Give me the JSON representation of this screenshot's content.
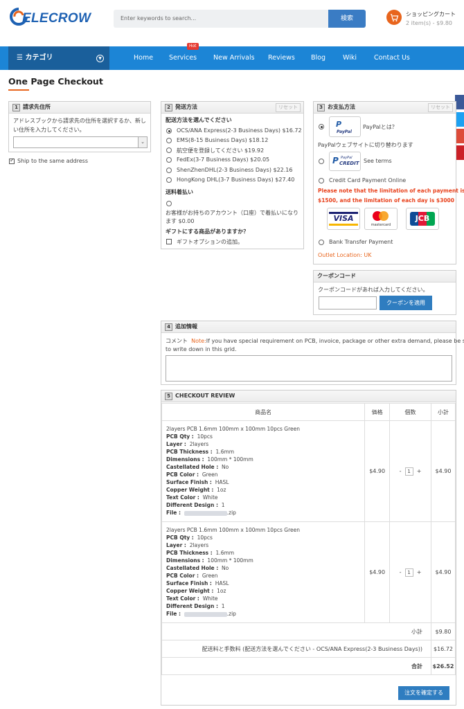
{
  "header": {
    "brand": "ELECROW",
    "search_placeholder": "Enter keywords to search...",
    "search_button": "検索",
    "cart_title": "ショッピングカート",
    "cart_summary": "2 item(s) - $9.80"
  },
  "nav": {
    "categories": "カテゴリ",
    "items": [
      "Home",
      "Services",
      "New Arrivals",
      "Reviews",
      "Blog",
      "Wiki",
      "Contact Us"
    ],
    "hot_badge": "Hot"
  },
  "page_title": "One Page Checkout",
  "billing": {
    "num": "1",
    "title": "請求先住所",
    "desc_line1": "アドレスブックから請求先の住所を選択するか、新し",
    "desc_line2": "い住所を入力してください。",
    "select_value": "",
    "same_address": "Ship to the same address"
  },
  "shipping": {
    "num": "2",
    "title": "発送方法",
    "reset": "リセット",
    "choose": "配送方法を選んでください",
    "options": [
      "OCS/ANA Express(2-3 Business Days) $16.72",
      "EMS(8-15 Business Days) $18.12",
      "航空便を登録してください $19.92",
      "FedEx(3-7 Business Days) $20.05",
      "ShenZhenDHL(2-3 Business Days) $22.16",
      "HongKong DHL(3-7 Business Days) $27.40"
    ],
    "cod_title": "送料着払い",
    "cod_desc_line1": "お客様がお持ちのアカウント（口座）で着払いになり",
    "cod_desc_line2": "ます $0.00",
    "gift_title": "ギフトにする商品がありますか？",
    "gift_option": "ギフトオプションの追加。"
  },
  "payment": {
    "num": "3",
    "title": "お支払方法",
    "reset": "リセット",
    "paypal_what": "PayPalとは？",
    "paypal_redirect": "PayPalウェブサイトに切り替わります",
    "paypal_credit_terms": "See terms",
    "credit_card": "Credit Card Payment Online",
    "limit_note_line1": "Please note that the limitation of each payment is",
    "limit_note_line2": "$1500, and the limitation of each day is $3000",
    "bank_transfer": "Bank Transfer Payment",
    "outlet": "Outlet Location: UK",
    "paypal_logo": "PayPal",
    "paypal_credit_logo_top": "PayPal",
    "paypal_credit_logo_bottom": "CREDIT",
    "visa": "VISA",
    "mastercard": "mastercard",
    "jcb": "JCB"
  },
  "coupon": {
    "title": "クーポンコード",
    "desc": "クーポンコードがあれば入力してください。",
    "button": "クーポンを適用",
    "value": ""
  },
  "additional": {
    "num": "4",
    "title": "追加情報",
    "comment_label": "コメント",
    "note_label": "Note:",
    "note_line1": "If you have special requirement on PCB, invoice, package or other extra demand, please be sure",
    "note_line2": "to write down in this grid."
  },
  "review": {
    "num": "5",
    "title": "CHECKOUT REVIEW",
    "headers": [
      "商品名",
      "価格",
      "個数",
      "小計"
    ],
    "items": [
      {
        "name": "2layers PCB 1.6mm 100mm x 100mm 10pcs Green",
        "specs": [
          {
            "k": "PCB Qty :",
            "v": "10pcs"
          },
          {
            "k": "Layer :",
            "v": "2layers"
          },
          {
            "k": "PCB Thickness :",
            "v": "1.6mm"
          },
          {
            "k": "Dimensions :",
            "v": "100mm * 100mm"
          },
          {
            "k": "Castellated Hole :",
            "v": "No"
          },
          {
            "k": "PCB Color :",
            "v": "Green"
          },
          {
            "k": "Surface Finish :",
            "v": "HASL"
          },
          {
            "k": "Copper Weight :",
            "v": "1oz"
          },
          {
            "k": "Text Color :",
            "v": "White"
          },
          {
            "k": "Different Design :",
            "v": "1"
          }
        ],
        "file_label": "File :",
        "file_ext": ".zip",
        "price": "$4.90",
        "qty": "1",
        "subtotal": "$4.90"
      },
      {
        "name": "2layers PCB 1.6mm 100mm x 100mm 10pcs Green",
        "specs": [
          {
            "k": "PCB Qty :",
            "v": "10pcs"
          },
          {
            "k": "Layer :",
            "v": "2layers"
          },
          {
            "k": "PCB Thickness :",
            "v": "1.6mm"
          },
          {
            "k": "Dimensions :",
            "v": "100mm * 100mm"
          },
          {
            "k": "Castellated Hole :",
            "v": "No"
          },
          {
            "k": "PCB Color :",
            "v": "Green"
          },
          {
            "k": "Surface Finish :",
            "v": "HASL"
          },
          {
            "k": "Copper Weight :",
            "v": "1oz"
          },
          {
            "k": "Text Color :",
            "v": "White"
          },
          {
            "k": "Different Design :",
            "v": "1"
          }
        ],
        "file_label": "File :",
        "file_ext": ".zip",
        "price": "$4.90",
        "qty": "1",
        "subtotal": "$4.90"
      }
    ],
    "subtotal_label": "小計",
    "subtotal_value": "$9.80",
    "shipping_label": "配送料と手数料 (配送方法を選んでください - OCS/ANA Express(2-3 Business Days))",
    "shipping_value": "$16.72",
    "total_label": "合計",
    "total_value": "$26.52",
    "confirm_button": "注文を確定する"
  },
  "colors": {
    "nav_blue": "#1c85d6",
    "category_blue": "#1a5f9b",
    "button_blue": "#2f7dc0",
    "accent_orange": "#e8651d",
    "warning_red": "#e8421d"
  }
}
